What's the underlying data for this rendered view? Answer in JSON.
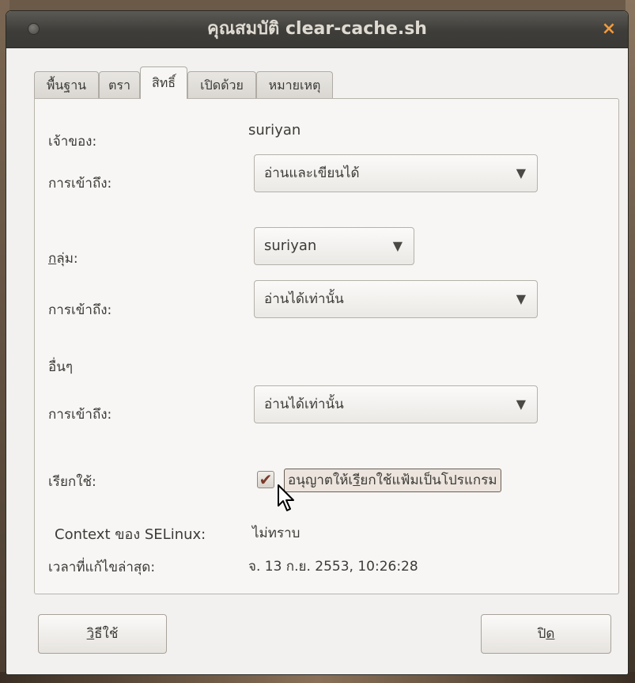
{
  "window": {
    "title": "คุณสมบัติ clear-cache.sh",
    "close_glyph": "×"
  },
  "tabs": [
    {
      "label": "พื้นฐาน",
      "active": false
    },
    {
      "label": "ตรา",
      "active": false
    },
    {
      "label": "สิทธิ์",
      "active": true
    },
    {
      "label": "เปิดด้วย",
      "active": false
    },
    {
      "label": "หมายเหตุ",
      "active": false
    }
  ],
  "owner": {
    "label": "เจ้าของ:",
    "value": "suriyan",
    "access_label": "การเข้าถึง:",
    "access_value": "อ่านและเขียนได้"
  },
  "group": {
    "label_u": "ก",
    "label_rest": "ลุ่ม:",
    "value": "suriyan",
    "access_label": "การเข้าถึง:",
    "access_value": "อ่านได้เท่านั้น"
  },
  "others": {
    "heading": "อื่นๆ",
    "access_label": "การเข้าถึง:",
    "access_value": "อ่านได้เท่านั้น"
  },
  "execute": {
    "label": "เรียกใช้:",
    "checked": true,
    "check_glyph": "✔",
    "checkbox_text_pre": "อนุญาตให้เ",
    "checkbox_text_u": "รี",
    "checkbox_text_post": "ยกใช้แฟ้มเป็นโปรแกรม"
  },
  "selinux": {
    "label": "Context ของ SELinux:",
    "value": "ไม่ทราบ"
  },
  "modified": {
    "label": "เวลาที่แก้ไขล่าสุด:",
    "value": "จ. 13 ก.ย. 2553, 10:26:28"
  },
  "arrow_glyph": "▼",
  "buttons": {
    "help_u": "วิ",
    "help_rest": "ธีใช้",
    "close_pre": "ปิ",
    "close_u": "ด"
  },
  "colors": {
    "titlebar": "#3e3d39",
    "window_bg": "#f2f1ef",
    "close_icon": "#f39a3a",
    "check_accent": "#7a3a2c"
  }
}
